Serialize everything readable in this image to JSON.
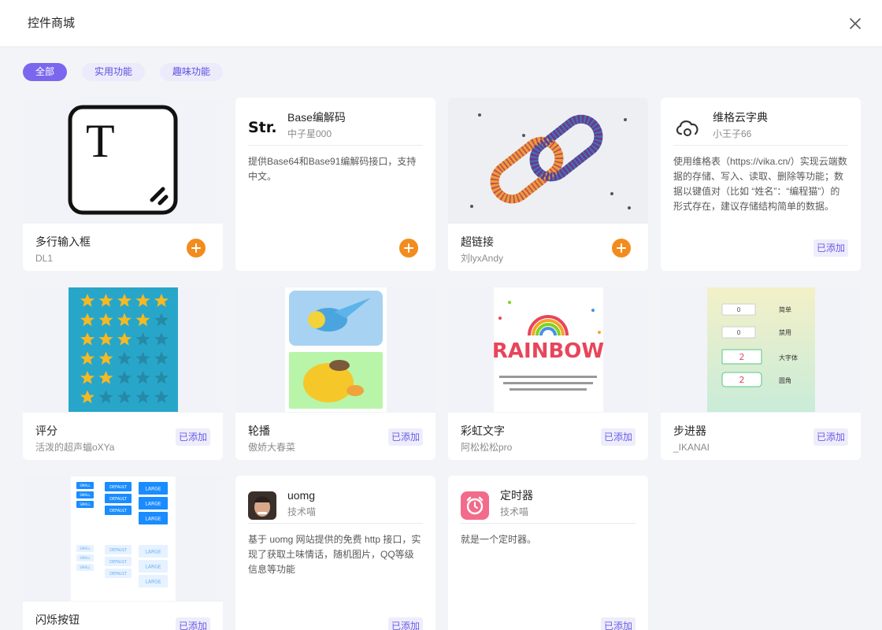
{
  "dialog": {
    "title": "控件商城"
  },
  "filters": [
    {
      "label": "全部",
      "active": true
    },
    {
      "label": "实用功能",
      "active": false
    },
    {
      "label": "趣味功能",
      "active": false
    }
  ],
  "labels": {
    "added": "已添加"
  },
  "cover_text": {
    "rainbow": "RAINBOW",
    "letter_t": "T"
  },
  "cards": [
    {
      "name": "多行输入框",
      "author": "DL1",
      "state": "add"
    },
    {
      "name": "Base编解码",
      "author": "中子星000",
      "description": "提供Base64和Base91编解码接口，支持中文。",
      "icon_text": "Str.",
      "state": "add"
    },
    {
      "name": "超链接",
      "author": "刘lyxAndy",
      "state": "add"
    },
    {
      "name": "维格云字典",
      "author": "小王子66",
      "description": "使用维格表（https://vika.cn/）实现云端数据的存储、写入、读取、删除等功能；数据以键值对（比如 “姓名”：“编程猫”）的形式存在，建议存储结构简单的数据。",
      "state": "added"
    },
    {
      "name": "评分",
      "author": "活泼的超声蝠oXYa",
      "state": "added"
    },
    {
      "name": "轮播",
      "author": "傲娇大春菜",
      "state": "added"
    },
    {
      "name": "彩虹文字",
      "author": "阿松松松pro",
      "state": "added"
    },
    {
      "name": "步进器",
      "author": "_IKANAI",
      "state": "added",
      "cover_rows": [
        {
          "value": "0",
          "label": "简单"
        },
        {
          "value": "0",
          "label": "禁用"
        },
        {
          "value": "2",
          "label": "大字体"
        },
        {
          "value": "2",
          "label": "圆角"
        }
      ]
    },
    {
      "name": "闪烁按钮",
      "author": "",
      "state": "added",
      "cover_buttons": {
        "small": "SMALL",
        "default": "DEFAULT",
        "large": "LARGE"
      }
    },
    {
      "name": "uomg",
      "author": "技术喵",
      "description": "基于 uomg 网站提供的免费 http 接口，实现了获取土味情话，随机图片，QQ等级信息等功能",
      "state": "added"
    },
    {
      "name": "定时器",
      "author": "技术喵",
      "description": "就是一个定时器。",
      "state": "added"
    }
  ]
}
